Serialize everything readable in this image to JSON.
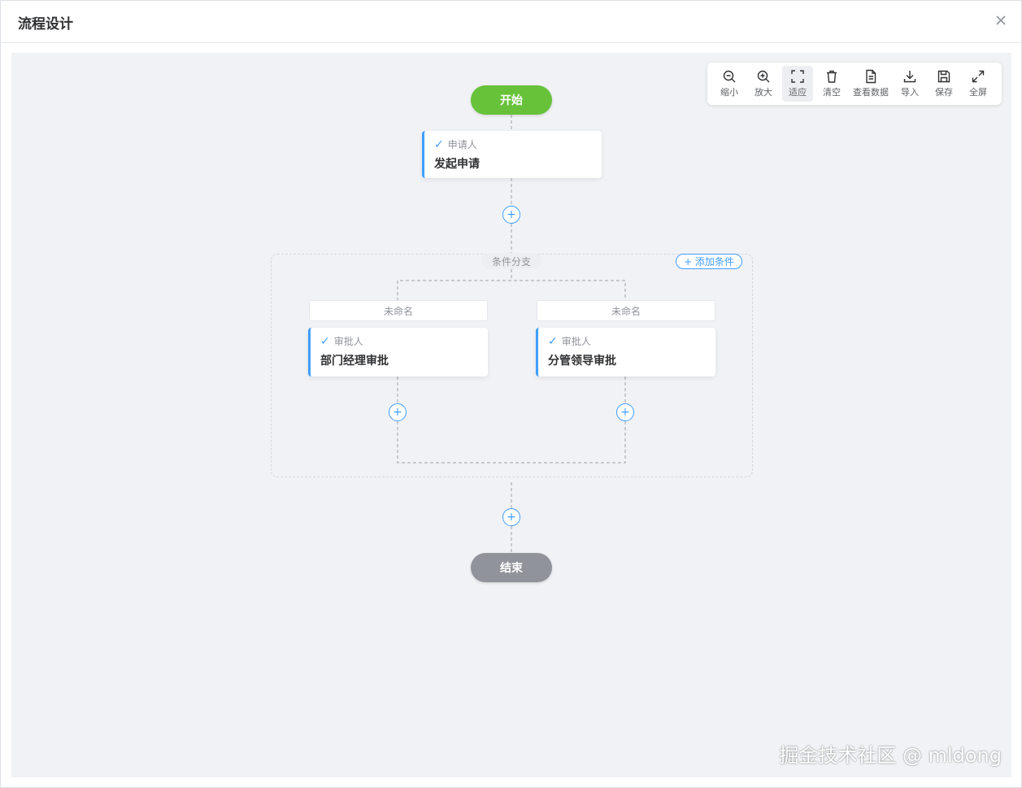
{
  "dialog": {
    "title": "流程设计",
    "close_icon": "close-icon"
  },
  "toolbar": {
    "items": [
      {
        "label": "缩小",
        "icon": "zoom-out-icon"
      },
      {
        "label": "放大",
        "icon": "zoom-in-icon"
      },
      {
        "label": "适应",
        "icon": "fit-screen-icon"
      },
      {
        "label": "清空",
        "icon": "trash-icon"
      },
      {
        "label": "查看数据",
        "icon": "document-icon"
      },
      {
        "label": "导入",
        "icon": "download-icon"
      },
      {
        "label": "保存",
        "icon": "save-icon"
      },
      {
        "label": "全屏",
        "icon": "fullscreen-icon"
      }
    ]
  },
  "flow": {
    "start": "开始",
    "end": "结束",
    "applicant": {
      "type": "申请人",
      "name": "发起申请"
    },
    "branch": {
      "label": "条件分支",
      "add_condition": "+ 添加条件",
      "conditions": [
        {
          "name": "未命名",
          "type": "审批人",
          "node": "部门经理审批"
        },
        {
          "name": "未命名",
          "type": "审批人",
          "node": "分管领导审批"
        }
      ]
    },
    "add_symbol": "+"
  },
  "colors": {
    "accent": "#409eff",
    "start": "#67c23a",
    "end": "#909399",
    "canvas": "#f0f2f5"
  },
  "watermark": "掘金技术社区 @ mldong"
}
